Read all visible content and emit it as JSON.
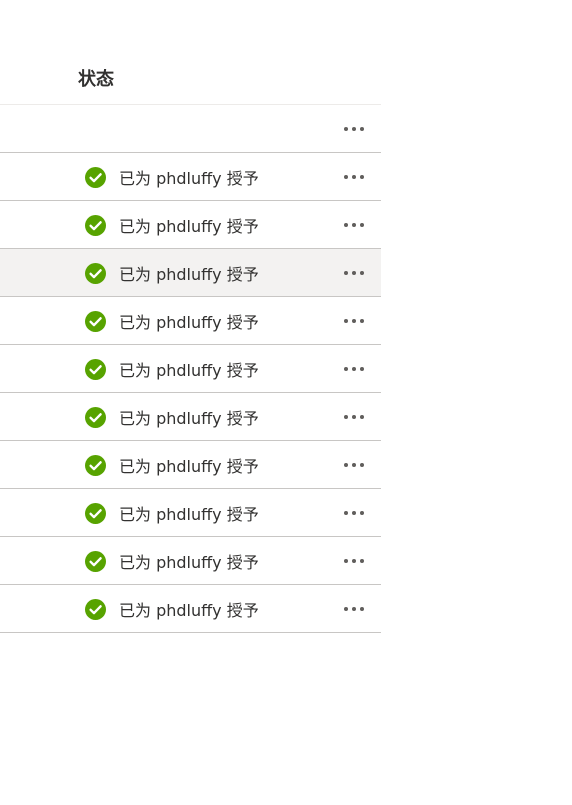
{
  "table": {
    "header": {
      "partial_column": "：",
      "status_column": "状态"
    },
    "rows": [
      {
        "status": "",
        "hovered": false
      },
      {
        "status": "已为 phdluffy 授予",
        "hovered": false
      },
      {
        "status": "已为 phdluffy 授予",
        "hovered": false
      },
      {
        "status": "已为 phdluffy 授予",
        "hovered": true
      },
      {
        "status": "已为 phdluffy 授予",
        "hovered": false
      },
      {
        "status": "已为 phdluffy 授予",
        "hovered": false
      },
      {
        "status": "已为 phdluffy 授予",
        "hovered": false
      },
      {
        "status": "已为 phdluffy 授予",
        "hovered": false
      },
      {
        "status": "已为 phdluffy 授予",
        "hovered": false
      },
      {
        "status": "已为 phdluffy 授予",
        "hovered": false
      },
      {
        "status": "已为 phdluffy 授予",
        "hovered": false
      }
    ]
  },
  "icons": {
    "status_icon": "check-circle-icon",
    "row_action": "more-horizontal-icon"
  },
  "colors": {
    "success_green": "#57a300",
    "hover_row": "#f3f2f1",
    "divider": "#c8c6c4"
  }
}
